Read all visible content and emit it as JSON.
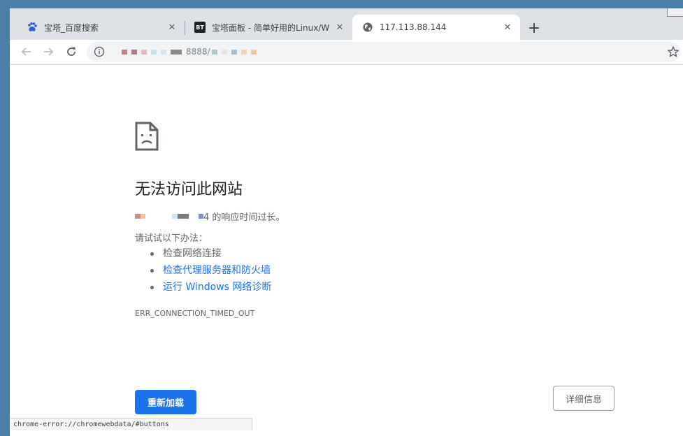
{
  "tabs": [
    {
      "title": "宝塔_百度搜索",
      "favicon": "baidu-paw-icon",
      "active": false
    },
    {
      "title": "宝塔面板 - 简单好用的Linux/Wi",
      "favicon": "bt-logo-icon",
      "favicon_text": "BT",
      "active": false
    },
    {
      "title": "117.113.88.144",
      "favicon": "globe-icon",
      "active": true
    }
  ],
  "toolbar": {
    "url_visible_text": "8888/",
    "icons": [
      "back-arrow-icon",
      "forward-arrow-icon",
      "reload-icon",
      "info-icon",
      "bookmark-star-icon"
    ]
  },
  "error_page": {
    "heading": "无法访问此网站",
    "subline_suffix": "4 的响应时间过长。",
    "try_label": "请试试以下办法：",
    "suggestions": [
      {
        "text": "检查网络连接",
        "link": false
      },
      {
        "text": "检查代理服务器和防火墙",
        "link": true
      },
      {
        "text": "运行 Windows 网络诊断",
        "link": true
      }
    ],
    "error_code": "ERR_CONNECTION_TIMED_OUT",
    "reload_label": "重新加载",
    "details_label": "详细信息"
  },
  "status_bar": {
    "text": "chrome-error://chromewebdata/#buttons"
  },
  "colors": {
    "accent": "#1a73e8",
    "tabstrip": "#dee1e6",
    "text_primary": "#202124",
    "text_secondary": "#5f6368"
  }
}
